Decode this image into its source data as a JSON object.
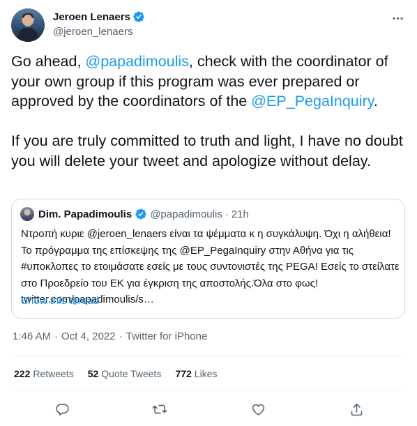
{
  "author": {
    "name": "Jeroen Lenaers",
    "handle": "@jeroen_lenaers"
  },
  "tweet": {
    "p1_a": "Go ahead, ",
    "p1_mention": "@papadimoulis",
    "p1_b": ", check with the coordinator of your own group if this program was ever prepared or approved by the coordinators of the ",
    "p1_mention2": "@EP_PegaInquiry",
    "p1_c": ".",
    "p2": "If you are truly committed to truth and light, I have no doubt you will delete your tweet and apologize without delay."
  },
  "quote": {
    "name": "Dim. Papadimoulis",
    "handle": "@papadimoulis",
    "dot": "·",
    "time": "21h",
    "t1": "Ντροπή κυριε ",
    "m1": "@jeroen_lenaers",
    "t2": " είναι τα ψέμματα κ η συγκάλυψη. Όχι η αλήθεια! Το πρόγραμμα της επίσκεψης της ",
    "m2": "@EP_PegaInquiry",
    "t3": " στην Αθήνα για τις #υποκλοπες το ετοιμάσατε εσείς με τους συντονιστές της PEGA! Εσείς το στείλατε στο Προεδρείο του ΕΚ για έγκριση της αποστολής.Όλα στο φως!",
    "t4": "twitter.com/papadimoulis/s…",
    "show_thread": "Show this thread"
  },
  "meta": {
    "time": "1:46 AM",
    "dot1": "·",
    "date": "Oct 4, 2022",
    "dot2": "·",
    "source": "Twitter for iPhone"
  },
  "stats": {
    "retweets_count": "222",
    "retweets_label": "Retweets",
    "quotes_count": "52",
    "quotes_label": "Quote Tweets",
    "likes_count": "772",
    "likes_label": "Likes"
  },
  "icons": {
    "verified": "verified-badge-icon",
    "more": "more-icon",
    "reply": "reply-icon",
    "retweet": "retweet-icon",
    "like": "like-icon",
    "share": "share-icon"
  },
  "colors": {
    "accent": "#1d9bf0",
    "muted": "#536471",
    "border": "#cfd9de"
  }
}
